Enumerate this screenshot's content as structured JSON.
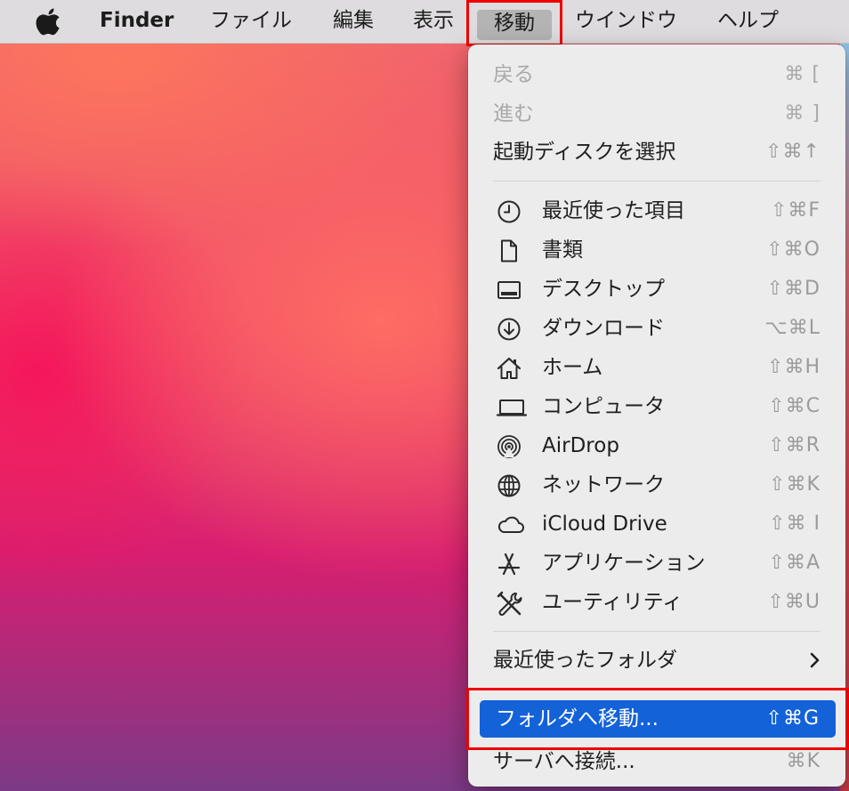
{
  "menubar": {
    "app_name": "Finder",
    "items": [
      "ファイル",
      "編集",
      "表示",
      "移動",
      "ウインドウ",
      "ヘルプ"
    ],
    "active_item": "移動"
  },
  "menu": {
    "items": [
      {
        "label": "戻る",
        "shortcut": "⌘ [",
        "disabled": true
      },
      {
        "label": "進む",
        "shortcut": "⌘ ]",
        "disabled": true
      },
      {
        "label": "起動ディスクを選択",
        "shortcut": "⇧⌘↑"
      },
      {
        "label": "最近使った項目",
        "shortcut": "⇧⌘F",
        "icon": "clock-icon"
      },
      {
        "label": "書類",
        "shortcut": "⇧⌘O",
        "icon": "document-icon"
      },
      {
        "label": "デスクトップ",
        "shortcut": "⇧⌘D",
        "icon": "desktop-icon"
      },
      {
        "label": "ダウンロード",
        "shortcut": "⌥⌘L",
        "icon": "download-icon"
      },
      {
        "label": "ホーム",
        "shortcut": "⇧⌘H",
        "icon": "home-icon"
      },
      {
        "label": "コンピュータ",
        "shortcut": "⇧⌘C",
        "icon": "laptop-icon"
      },
      {
        "label": "AirDrop",
        "shortcut": "⇧⌘R",
        "icon": "airdrop-icon"
      },
      {
        "label": "ネットワーク",
        "shortcut": "⇧⌘K",
        "icon": "globe-icon"
      },
      {
        "label": "iCloud Drive",
        "shortcut": "⇧⌘ I",
        "icon": "cloud-icon"
      },
      {
        "label": "アプリケーション",
        "shortcut": "⇧⌘A",
        "icon": "applications-icon"
      },
      {
        "label": "ユーティリティ",
        "shortcut": "⇧⌘U",
        "icon": "tools-icon"
      },
      {
        "label": "最近使ったフォルダ",
        "submenu": true
      },
      {
        "label": "フォルダへ移動...",
        "shortcut": "⇧⌘G",
        "highlighted": true
      },
      {
        "label": "サーバへ接続...",
        "shortcut": "⌘K"
      }
    ]
  },
  "colors": {
    "highlight": "#1362d8",
    "annotation_red": "#ee0000",
    "menubar_bg": "#dedcde",
    "menu_bg": "#ececec"
  }
}
